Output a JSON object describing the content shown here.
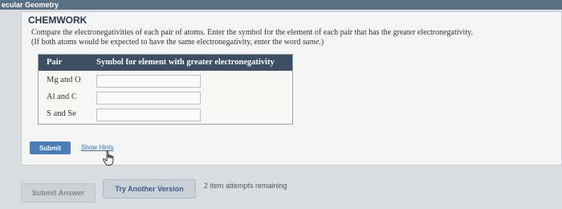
{
  "window": {
    "section_title": "ecular Geometry"
  },
  "panel": {
    "title": "CHEMWORK",
    "instructions_line1": "Compare the electronegativities of each pair of atoms. Enter the symbol for the element of each pair that has the greater electronegativity.",
    "instructions_line2_prefix": "(If both atoms would be expected to have the same electronegativity, enter the word ",
    "instructions_keyword": "same.",
    "instructions_line2_suffix": ")"
  },
  "table": {
    "headers": {
      "pair": "Pair",
      "symbol": "Symbol for element with greater electronegativity"
    },
    "rows": [
      {
        "pair": "Mg and O",
        "value": ""
      },
      {
        "pair": "Al and C",
        "value": ""
      },
      {
        "pair": "S and Se",
        "value": ""
      }
    ]
  },
  "actions": {
    "submit_label": "Submit",
    "show_hints_label": "Show Hints",
    "submit_answer_label": "Submit Answer",
    "try_another_label": "Try Another Version",
    "attempts_text": "2 item attempts remaining"
  },
  "icons": {
    "cursor": "hand-pointer-icon"
  },
  "colors": {
    "header_bar": "#5b6f84",
    "table_header": "#3c4e64",
    "submit_button": "#4a7db8",
    "link": "#3a6fb0"
  }
}
